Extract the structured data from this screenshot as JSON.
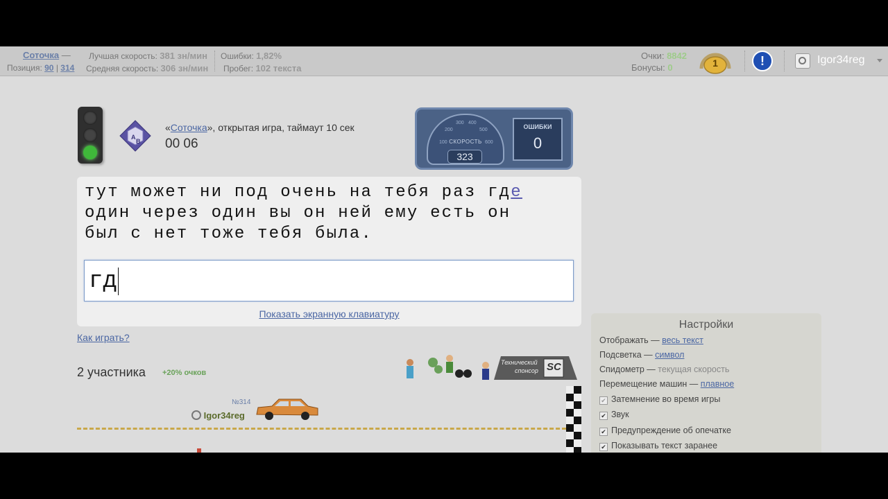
{
  "topbar": {
    "username_link": "Соточка",
    "dash": "—",
    "position_label": "Позиция:",
    "position_value1": "90",
    "position_sep": "|",
    "position_value2": "314",
    "best_speed_label": "Лучшая скорость:",
    "best_speed_value": "381 зн/мин",
    "avg_speed_label": "Средняя скорость:",
    "avg_speed_value": "306 зн/мин",
    "errors_label": "Ошибки:",
    "errors_value": "1,82%",
    "mileage_label": "Пробег:",
    "mileage_value": "102 текста",
    "points_label": "Очки:",
    "points_value": "8842",
    "bonus_label": "Бонусы:",
    "bonus_value": "0",
    "level_badge": "1",
    "alert_symbol": "!",
    "user_name": "Igor34reg"
  },
  "game": {
    "quote_open": "«",
    "mode_link": "Соточка",
    "quote_rest": "», открытая игра, таймаут 10 сек",
    "timer": "00 06",
    "race_cube_letter_a": "A",
    "race_cube_letter_b": "B"
  },
  "speedometer": {
    "title": "СКОРОСТЬ",
    "value": "323",
    "errors_title": "ОШИБКИ",
    "errors_value": "0",
    "scale": [
      "100",
      "200",
      "300",
      "400",
      "500",
      "600"
    ]
  },
  "typing": {
    "text_before": "тут может ни под очень на тебя раз гд",
    "text_current": "е",
    "text_line2": "один через один вы он ней ему есть он",
    "text_line3": "был с нет тоже тебя была.",
    "input_value": "гд",
    "keyboard_link": "Показать экранную клавиатуру"
  },
  "help_link": "Как играть?",
  "participants": {
    "label": "2 участника",
    "bonus": "+20% очков"
  },
  "racer": {
    "rank": "№314",
    "name": "Igor34reg"
  },
  "sponsor": {
    "line1": "Технический",
    "line2": "спонсор",
    "logo": "SC"
  },
  "settings": {
    "title": "Настройки",
    "display_label": "Отображать —",
    "display_value": "весь текст",
    "highlight_label": "Подсветка —",
    "highlight_value": "символ",
    "speedo_label": "Спидометр —",
    "speedo_value": "текущая скорость",
    "cars_label": "Перемещение машин —",
    "cars_value": "плавное",
    "dim_label": "Затемнение во время игры",
    "sound_label": "Звук",
    "typo_label": "Предупреждение об опечатке",
    "preview_label": "Показывать текст заранее"
  },
  "colors": {
    "accent_green": "#7fb36a",
    "link_blue": "#4a66a3"
  }
}
